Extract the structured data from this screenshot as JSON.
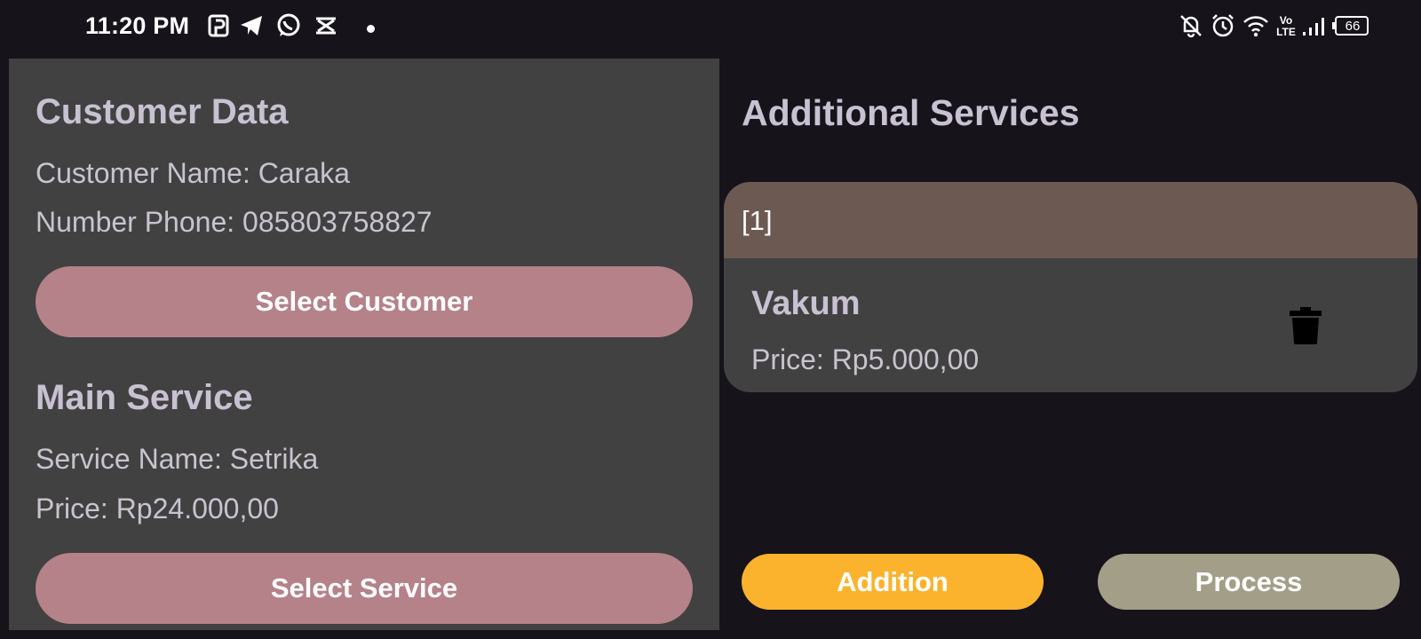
{
  "status_bar": {
    "time": "11:20 PM",
    "battery": "66",
    "notification_icons": [
      "pinterest-icon",
      "telegram-icon",
      "whatsapp-icon",
      "capcut-icon",
      "dot-icon"
    ],
    "system_icons": [
      "bell-off-icon",
      "alarm-icon",
      "wifi-icon",
      "volte-icon",
      "signal-icon",
      "battery-icon"
    ],
    "volte_top": "Vo",
    "volte_bottom": "LTE"
  },
  "customer": {
    "title": "Customer Data",
    "name_line": "Customer Name: Caraka",
    "phone_line": "Number Phone: 085803758827",
    "select_label": "Select Customer"
  },
  "main_service": {
    "title": "Main Service",
    "name_line": "Service Name: Setrika",
    "price_line": "Price: Rp24.000,00",
    "select_label": "Select Service"
  },
  "additional": {
    "title": "Additional Services",
    "items": [
      {
        "index": "[1]",
        "name": "Vakum",
        "price": "Price: Rp5.000,00",
        "icon": "trash-icon"
      }
    ]
  },
  "actions": {
    "addition_label": "Addition",
    "process_label": "Process"
  },
  "colors": {
    "background": "#16131a",
    "panel": "#414141",
    "select_button": "#b5828a",
    "card_header": "#6c5a52",
    "addition_button": "#fbb32d",
    "process_button": "#a39e87"
  }
}
